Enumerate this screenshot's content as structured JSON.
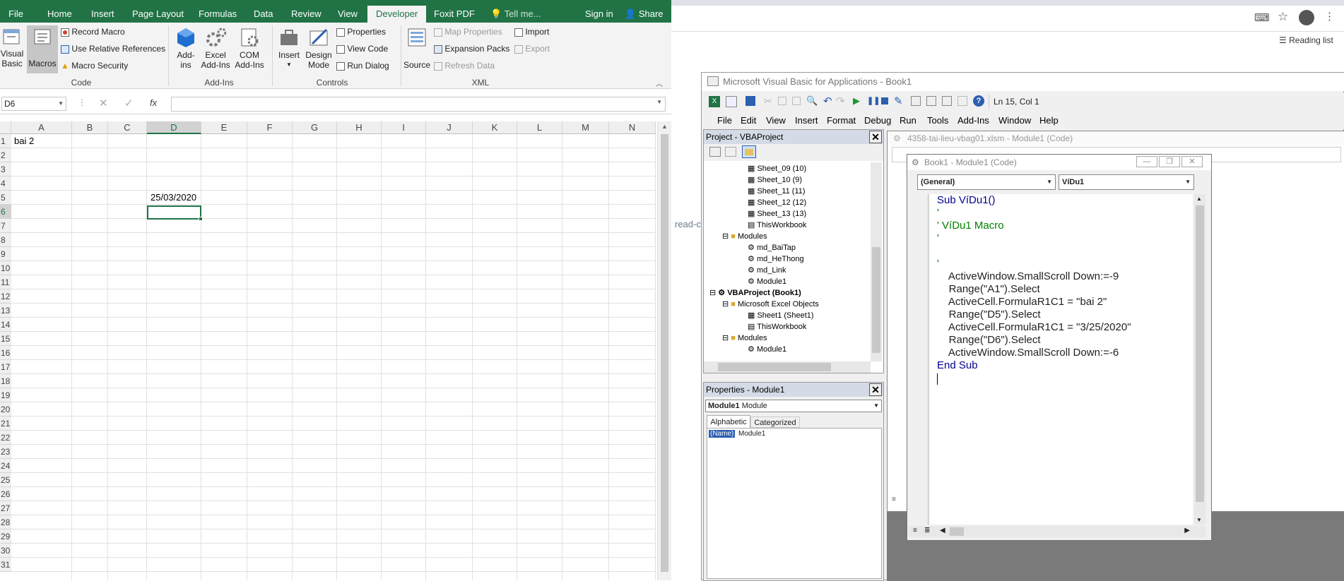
{
  "excel": {
    "tabs": [
      "File",
      "Home",
      "Insert",
      "Page Layout",
      "Formulas",
      "Data",
      "Review",
      "View",
      "Developer",
      "Foxit PDF",
      "Tell me...",
      "Sign in",
      "Share"
    ],
    "ribbon": {
      "visual_basic": "Visual Basic",
      "macros": "Macros",
      "record_macro": "Record Macro",
      "use_relative": "Use Relative References",
      "macro_security": "Macro Security",
      "group_code": "Code",
      "add_ins": "Add-ins",
      "excel_add_ins": "Excel Add-Ins",
      "com_add_ins": "COM Add-Ins",
      "group_addins": "Add-Ins",
      "insert": "Insert",
      "design_mode": "Design Mode",
      "properties": "Properties",
      "view_code": "View Code",
      "run_dialog": "Run Dialog",
      "group_controls": "Controls",
      "source": "Source",
      "map_properties": "Map Properties",
      "expansion_packs": "Expansion Packs",
      "refresh_data": "Refresh Data",
      "import": "Import",
      "export": "Export",
      "group_xml": "XML"
    },
    "name_box": "D6",
    "fx": "fx",
    "columns": [
      "A",
      "B",
      "C",
      "D",
      "E",
      "F",
      "G",
      "H",
      "I",
      "J",
      "K",
      "L",
      "M",
      "N"
    ],
    "rows": [
      "1",
      "2",
      "3",
      "4",
      "5",
      "6",
      "7",
      "8",
      "9",
      "10",
      "11",
      "12",
      "13",
      "14",
      "15",
      "16",
      "17",
      "18",
      "19",
      "20",
      "21",
      "22",
      "23",
      "24",
      "25",
      "26",
      "27",
      "28",
      "29",
      "30",
      "31"
    ],
    "a1": "bai 2",
    "d5": "25/03/2020"
  },
  "browser": {
    "reading_list": "Reading list",
    "side_text": "read-c"
  },
  "vba": {
    "title": "Microsoft Visual Basic for Applications - Book1",
    "position": "Ln 15, Col 1",
    "menu": [
      "File",
      "Edit",
      "View",
      "Insert",
      "Format",
      "Debug",
      "Run",
      "Tools",
      "Add-Ins",
      "Window",
      "Help"
    ],
    "project_title": "Project - VBAProject",
    "tree": [
      "Sheet_09 (10)",
      "Sheet_10 (9)",
      "Sheet_11 (11)",
      "Sheet_12 (12)",
      "Sheet_13 (13)",
      "ThisWorkbook",
      "Modules",
      "md_BaiTap",
      "md_HeThong",
      "md_Link",
      "Module1",
      "VBAProject (Book1)",
      "Microsoft Excel Objects",
      "Sheet1 (Sheet1)",
      "ThisWorkbook",
      "Modules",
      "Module1"
    ],
    "props_title": "Properties - Module1",
    "props_object": "Module1",
    "props_type": "Module",
    "props_tabs": [
      "Alphabetic",
      "Categorized"
    ],
    "props_name_key": "(Name)",
    "props_name_val": "Module1",
    "bg_window_title": "4358-tai-lieu-vbag01.xlsm - Module1 (Code)",
    "code_title": "Book1 - Module1 (Code)",
    "general": "(General)",
    "proc": "VíDu1",
    "code": [
      "Sub VíDu1()",
      "'",
      "' VíDu1 Macro",
      "'",
      "",
      "'",
      "    ActiveWindow.SmallScroll Down:=-9",
      "    Range(\"A1\").Select",
      "    ActiveCell.FormulaR1C1 = \"bai 2\"",
      "    Range(\"D5\").Select",
      "    ActiveCell.FormulaR1C1 = \"3/25/2020\"",
      "    Range(\"D6\").Select",
      "    ActiveWindow.SmallScroll Down:=-6",
      "End Sub"
    ]
  }
}
